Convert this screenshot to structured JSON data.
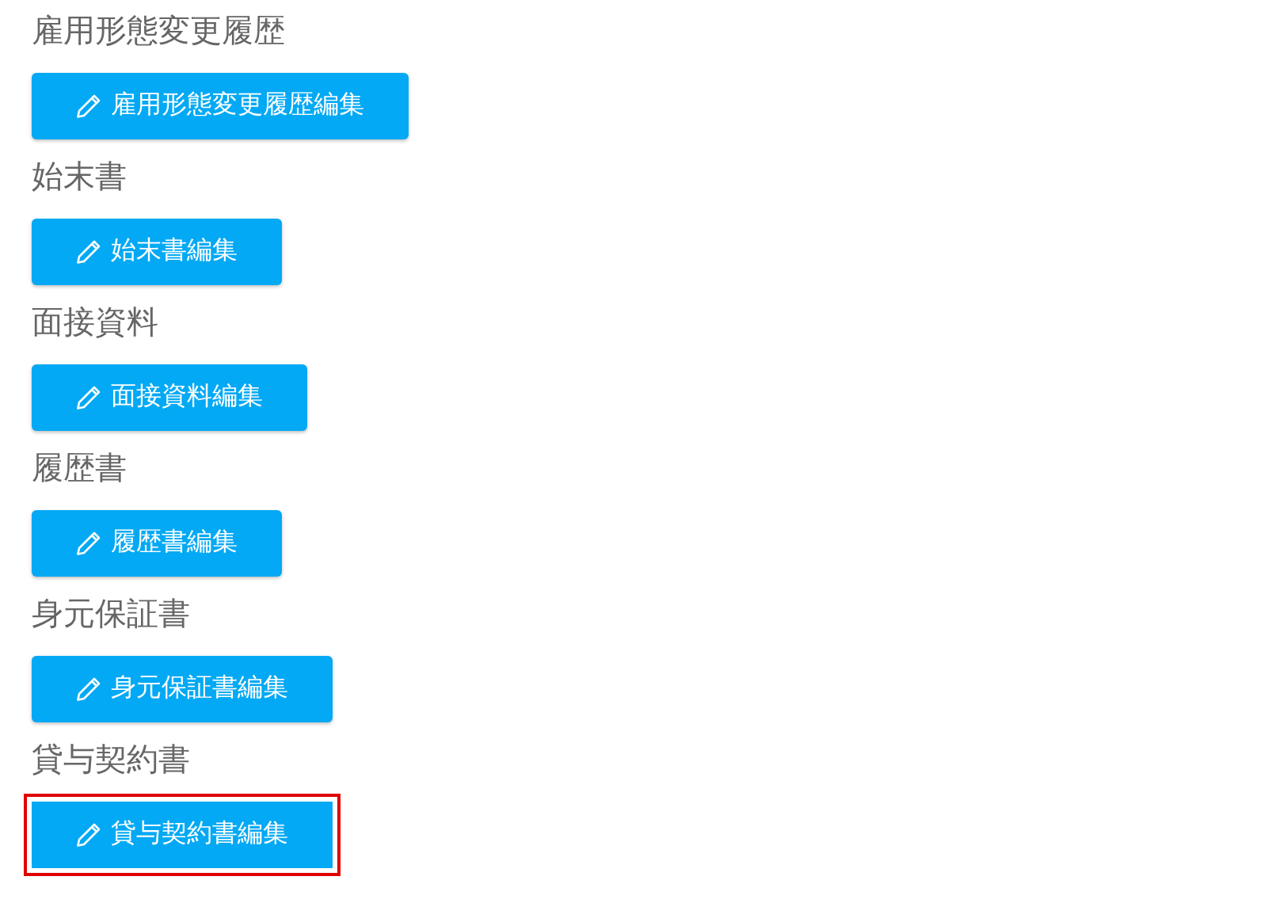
{
  "sections": [
    {
      "heading": "雇用形態変更履歴",
      "button": {
        "label": "雇用形態変更履歴編集",
        "highlighted": false
      }
    },
    {
      "heading": "始末書",
      "button": {
        "label": "始末書編集",
        "highlighted": false
      }
    },
    {
      "heading": "面接資料",
      "button": {
        "label": "面接資料編集",
        "highlighted": false
      }
    },
    {
      "heading": "履歴書",
      "button": {
        "label": "履歴書編集",
        "highlighted": false
      }
    },
    {
      "heading": "身元保証書",
      "button": {
        "label": "身元保証書編集",
        "highlighted": false
      }
    },
    {
      "heading": "貸与契約書",
      "button": {
        "label": "貸与契約書編集",
        "highlighted": true
      }
    }
  ]
}
